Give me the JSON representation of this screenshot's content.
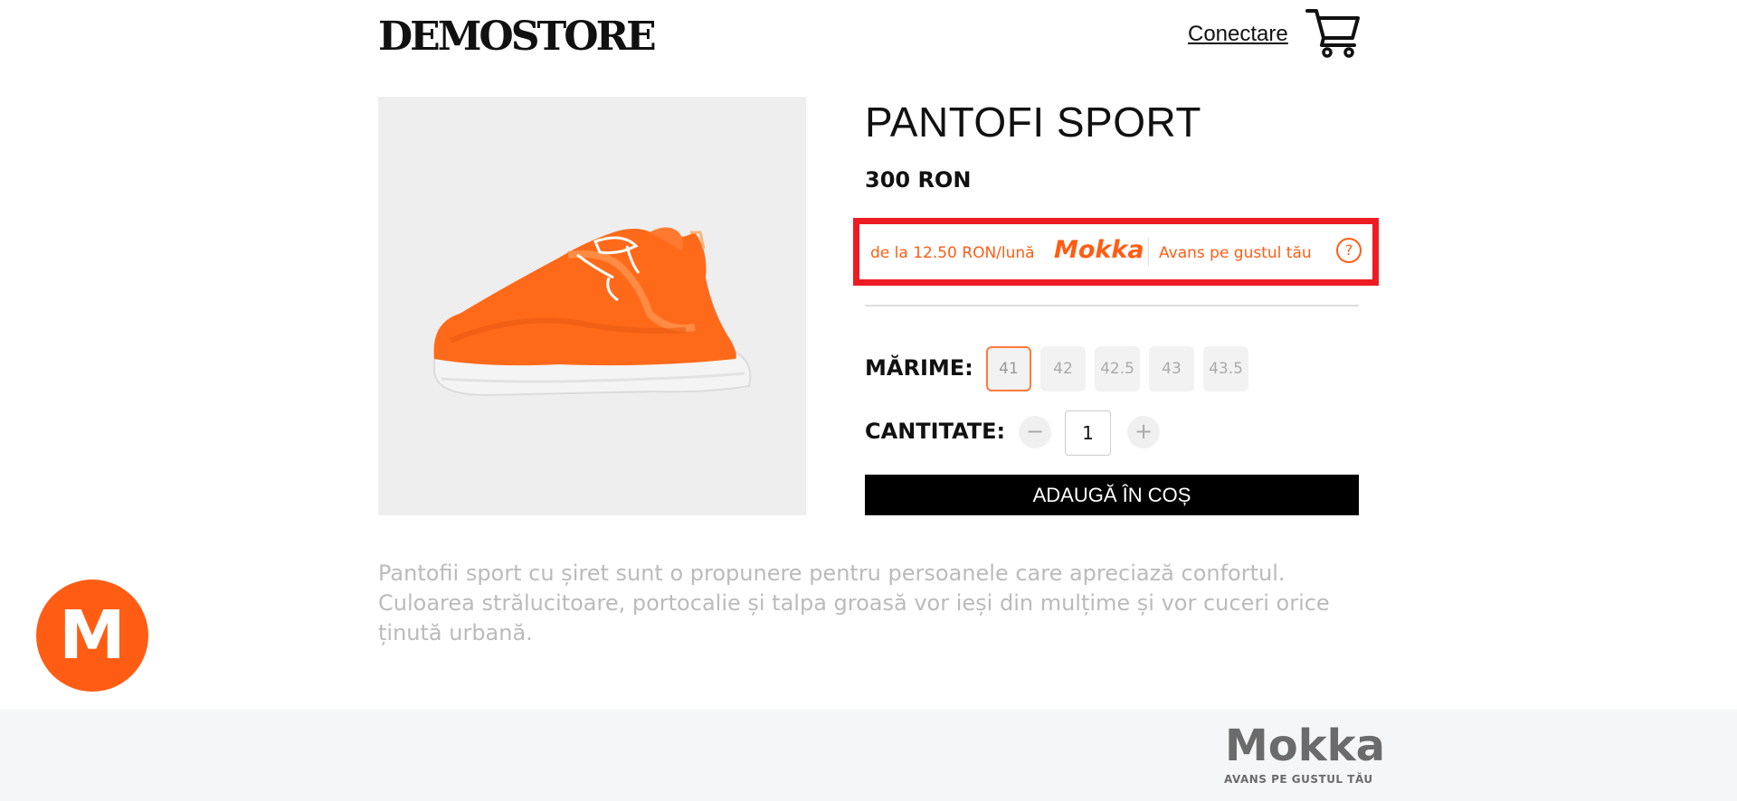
{
  "header": {
    "store_name": "DEMOSTORE",
    "login_label": "Conectare",
    "cart_icon": "shopping-cart-icon"
  },
  "product": {
    "title": "PANTOFI SPORT",
    "price": "300 RON",
    "image_icon": "orange-sneaker-image",
    "description": "Pantofii sport cu șiret sunt o propunere pentru persoanele care apreciază confortul. Culoarea strălucitoare, portocalie și talpa groasă vor ieși din mulțime și vor cuceri orice ținută urbană."
  },
  "mokka_widget": {
    "installment_text": "de la 12.50 RON/lună",
    "logo": "Mokka",
    "tagline": "Avans pe gustul tău",
    "help_symbol": "?",
    "accent_color": "#ff5d14",
    "highlight_border_color": "#ed1c24"
  },
  "size": {
    "label": "MĂRIME:",
    "options": [
      "41",
      "42",
      "42.5",
      "43",
      "43.5"
    ],
    "selected": "41"
  },
  "quantity": {
    "label": "CANTITATE:",
    "value": "1",
    "minus_symbol": "−",
    "plus_symbol": "+"
  },
  "add_to_cart_label": "ADAUGĂ ÎN COȘ",
  "floating_button": {
    "letter": "M",
    "color": "#ff5d14"
  },
  "footer": {
    "logo": "Mokka",
    "tagline": "AVANS PE GUSTUL TĂU"
  }
}
